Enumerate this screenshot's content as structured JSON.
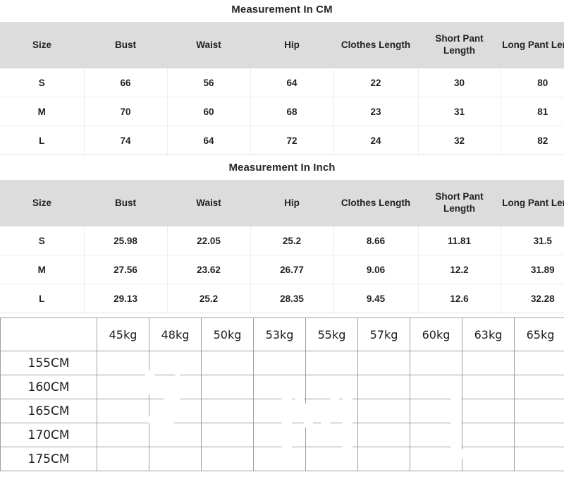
{
  "tables": [
    {
      "title": "Measurement In CM",
      "headers": [
        "Size",
        "Bust",
        "Waist",
        "Hip",
        "Clothes Length",
        "Short Pant Length",
        "Long Pant Length"
      ],
      "rows": [
        [
          "S",
          "66",
          "56",
          "64",
          "22",
          "30",
          "80"
        ],
        [
          "M",
          "70",
          "60",
          "68",
          "23",
          "31",
          "81"
        ],
        [
          "L",
          "74",
          "64",
          "72",
          "24",
          "32",
          "82"
        ]
      ]
    },
    {
      "title": "Measurement In Inch",
      "headers": [
        "Size",
        "Bust",
        "Waist",
        "Hip",
        "Clothes Length",
        "Short Pant Length",
        "Long Pant Length"
      ],
      "rows": [
        [
          "S",
          "25.98",
          "22.05",
          "25.2",
          "8.66",
          "11.81",
          "31.5"
        ],
        [
          "M",
          "27.56",
          "23.62",
          "26.77",
          "9.06",
          "12.2",
          "31.89"
        ],
        [
          "L",
          "29.13",
          "25.2",
          "28.35",
          "9.45",
          "12.6",
          "32.28"
        ]
      ]
    }
  ],
  "size_grid": {
    "corner_label": "",
    "weights": [
      "45kg",
      "48kg",
      "50kg",
      "53kg",
      "55kg",
      "57kg",
      "60kg",
      "63kg",
      "65kg"
    ],
    "heights": [
      "155CM",
      "160CM",
      "165CM",
      "170CM",
      "175CM"
    ],
    "watermarks": [
      "S",
      "M",
      "L"
    ],
    "fills": [
      [
        "light",
        "light",
        "light",
        "mid",
        "mid",
        "mid",
        "lav",
        "lav",
        "none"
      ],
      [
        "light",
        "light",
        "light",
        "mid",
        "mid",
        "mid",
        "lav",
        "lav",
        "lav"
      ],
      [
        "light",
        "light",
        "light",
        "mid",
        "mid",
        "mid",
        "lav",
        "lav",
        "lav"
      ],
      [
        "light",
        "light",
        "light",
        "mid",
        "mid",
        "mid",
        "lav",
        "lav",
        "lav"
      ],
      [
        "mid",
        "mid",
        "mid",
        "mid",
        "mid",
        "mid",
        "lav",
        "lav",
        "lav"
      ]
    ],
    "colors": {
      "light": "#e7eef4",
      "mid": "#c2d2de",
      "lav": "#cdd1e7",
      "none": "#ffffff",
      "border": "#9aa0a6",
      "watermark": "#ffffff"
    }
  },
  "colors": {
    "table_header_bg": "#dcdcdc",
    "text": "#231f20",
    "row_divider": "#ededed",
    "page_bg": "#ffffff"
  }
}
